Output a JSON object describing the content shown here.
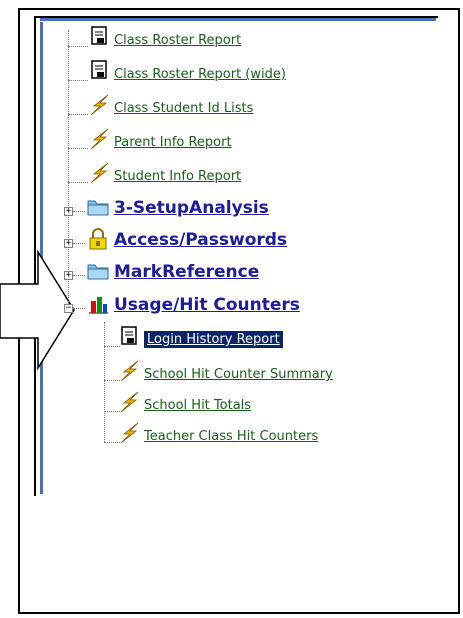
{
  "tree": {
    "top_leaves": [
      {
        "label": "Class Roster Report",
        "icon": "report-icon"
      },
      {
        "label": "Class Roster Report (wide)",
        "icon": "report-icon"
      },
      {
        "label": "Class Student Id Lists",
        "icon": "lightning-icon"
      },
      {
        "label": "Parent Info Report",
        "icon": "lightning-icon"
      },
      {
        "label": "Student Info Report",
        "icon": "lightning-icon"
      }
    ],
    "folders": [
      {
        "label": "3-SetupAnalysis",
        "icon": "folder-icon",
        "toggle": "+"
      },
      {
        "label": "Access/Passwords",
        "icon": "lock-icon",
        "toggle": "+"
      },
      {
        "label": "MarkReference",
        "icon": "folder-icon",
        "toggle": "+"
      },
      {
        "label": "Usage/Hit Counters",
        "icon": "bar-chart-icon",
        "toggle": "−"
      }
    ],
    "usage_children": [
      {
        "label": "Login History Report",
        "icon": "report-icon",
        "selected": true
      },
      {
        "label": "School Hit Counter Summary",
        "icon": "lightning-icon"
      },
      {
        "label": "School Hit Totals",
        "icon": "lightning-icon"
      },
      {
        "label": "Teacher Class Hit Counters",
        "icon": "lightning-icon"
      }
    ]
  },
  "colors": {
    "leaf_link": "#1a5e1a",
    "folder_link": "#1c1c9c",
    "selected_bg": "#0a246a",
    "pane_accent": "#4b6fb8"
  },
  "callout": {
    "shape": "arrow-right-outline"
  }
}
